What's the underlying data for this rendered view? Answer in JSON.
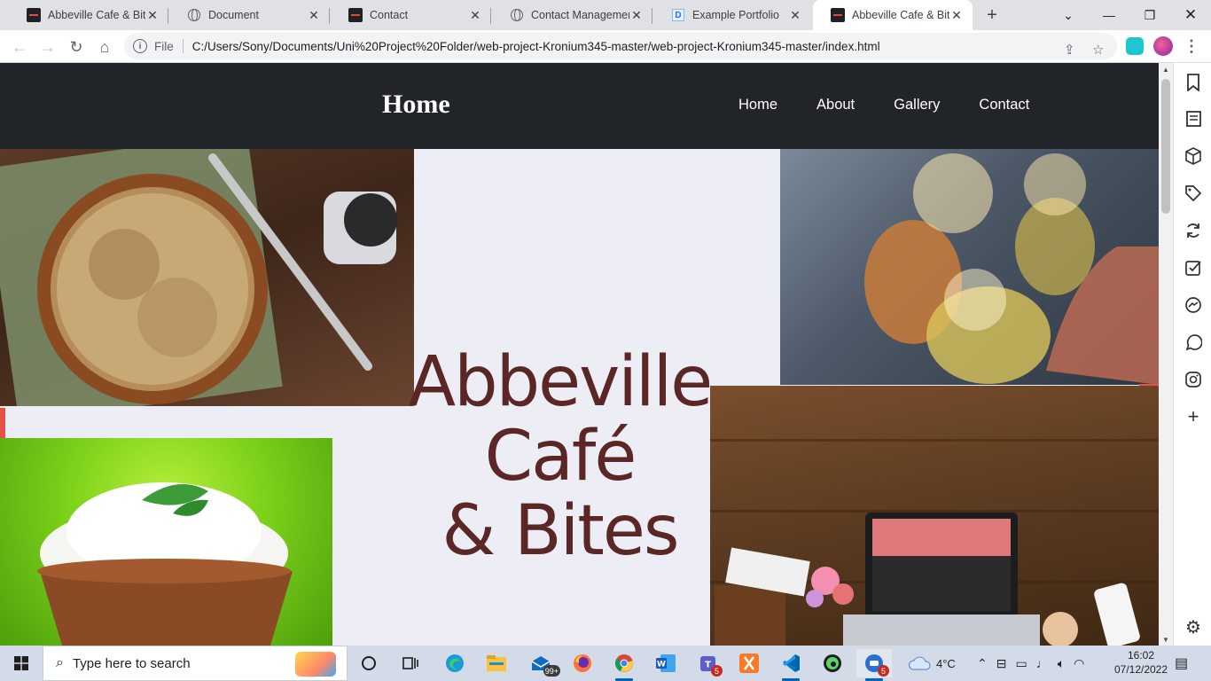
{
  "browser": {
    "tabs": [
      {
        "title": "Abbeville Cafe & Bites",
        "favicon": "site-favicon",
        "active": false
      },
      {
        "title": "Document",
        "favicon": "globe-icon",
        "active": false
      },
      {
        "title": "Contact",
        "favicon": "site-favicon",
        "active": false
      },
      {
        "title": "Contact Management",
        "favicon": "globe-icon",
        "active": false
      },
      {
        "title": "Example Portfolio",
        "favicon": "doc-icon",
        "active": false
      },
      {
        "title": "Abbeville Cafe & Bites",
        "favicon": "site-favicon",
        "active": true
      }
    ],
    "address_bar": {
      "scheme_label": "File",
      "url": "C:/Users/Sony/Documents/Uni%20Project%20Folder/web-project-Kronium345-master/web-project-Kronium345-master/index.html"
    }
  },
  "site": {
    "brand": "Home",
    "nav": [
      "Home",
      "About",
      "Gallery",
      "Contact"
    ],
    "hero_lines": [
      "Abbeville",
      "Café",
      "& Bites"
    ],
    "colors": {
      "header_bg": "#212529",
      "hero_text": "#5a2626",
      "page_bg": "#edeef5",
      "accent": "#e8504a"
    }
  },
  "sidebar_icons": [
    "bookmark-icon",
    "reading-list-icon",
    "cube-icon",
    "tag-icon",
    "sync-icon",
    "checklist-icon",
    "messenger-icon",
    "whatsapp-icon",
    "instagram-icon",
    "add-icon",
    "settings-icon"
  ],
  "taskbar": {
    "search_placeholder": "Type here to search",
    "mail_badge": "99+",
    "teams_badge": "5",
    "app_badge": "5",
    "weather": "4°C",
    "time": "16:02",
    "date": "07/12/2022"
  }
}
